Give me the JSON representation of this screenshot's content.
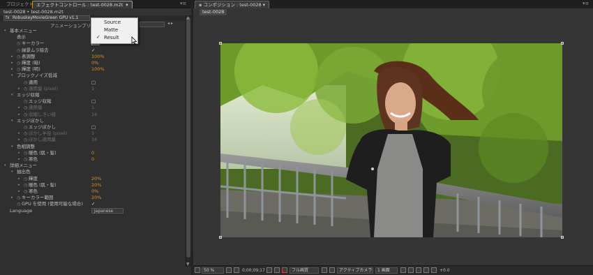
{
  "left_panel": {
    "tabs": [
      {
        "label": "プロジェクト"
      },
      {
        "label": "エフェクトコントロール : test-0028.m2t"
      }
    ],
    "menu_glyph": "▾≡",
    "subtitle": "test-0028 • test-0028.m2t",
    "effect_name": "RobuskeyMovieGreen GPU v1.1",
    "fx_label": "fx",
    "preset_label": "アニメーションプリセット"
  },
  "popup_menu": {
    "items": [
      "Source",
      "Matte",
      "Result"
    ],
    "checked_index": 2,
    "check_glyph": "✓"
  },
  "properties": [
    {
      "label": "基本メニュー",
      "value": "",
      "indent": 0,
      "tri": "▾"
    },
    {
      "label": "表示",
      "value": "",
      "indent": 1,
      "tri": ""
    },
    {
      "label": "キーカラー",
      "value": "",
      "indent": 1,
      "tri": "",
      "stopwatch": true,
      "swatch": true
    },
    {
      "label": "緑景ムラ除去",
      "value": "✓",
      "indent": 1,
      "tri": "",
      "stopwatch": true
    },
    {
      "label": "表調整",
      "value": "100%",
      "indent": 1,
      "tri": "▸",
      "stopwatch": true,
      "orange": true
    },
    {
      "label": "輝度 (暗)",
      "value": "0%",
      "indent": 1,
      "tri": "▸",
      "stopwatch": true,
      "orange": true
    },
    {
      "label": "輝度 (明)",
      "value": "100%",
      "indent": 1,
      "tri": "▸",
      "stopwatch": true,
      "orange": true
    },
    {
      "label": "ブロックノイズ低減",
      "value": "",
      "indent": 1,
      "tri": "▾"
    },
    {
      "label": "適用",
      "value": "□",
      "indent": 2,
      "tri": "",
      "stopwatch": true
    },
    {
      "label": "適用量 (pixel)",
      "value": "1",
      "indent": 2,
      "tri": "▸",
      "stopwatch": true,
      "dim": true
    },
    {
      "label": "エッジ収縮",
      "value": "",
      "indent": 1,
      "tri": "▾"
    },
    {
      "label": "エッジ収縮",
      "value": "□",
      "indent": 2,
      "tri": "",
      "stopwatch": true
    },
    {
      "label": "適用量",
      "value": "1",
      "indent": 2,
      "tri": "▸",
      "stopwatch": true,
      "dim": true
    },
    {
      "label": "収縮しきい値",
      "value": "16",
      "indent": 2,
      "tri": "▸",
      "stopwatch": true,
      "dim": true
    },
    {
      "label": "エッジぼかし",
      "value": "",
      "indent": 1,
      "tri": "▾"
    },
    {
      "label": "エッジぼかし",
      "value": "□",
      "indent": 2,
      "tri": "",
      "stopwatch": true
    },
    {
      "label": "ぼかし半径 (pixel)",
      "value": "1",
      "indent": 2,
      "tri": "▸",
      "stopwatch": true,
      "dim": true
    },
    {
      "label": "ぼかし適用量",
      "value": "16",
      "indent": 2,
      "tri": "▸",
      "stopwatch": true,
      "dim": true
    },
    {
      "label": "色相調整",
      "value": "",
      "indent": 1,
      "tri": "▾"
    },
    {
      "label": "暖色 (肌・髪)",
      "value": "0",
      "indent": 2,
      "tri": "▸",
      "stopwatch": true,
      "orange": true
    },
    {
      "label": "寒色",
      "value": "0",
      "indent": 2,
      "tri": "▸",
      "stopwatch": true,
      "orange": true
    },
    {
      "label": "詳細メニュー",
      "value": "",
      "indent": 0,
      "tri": "▾"
    },
    {
      "label": "抽出色",
      "value": "",
      "indent": 1,
      "tri": "▾"
    },
    {
      "label": "輝度",
      "value": "20%",
      "indent": 2,
      "tri": "▸",
      "stopwatch": true,
      "orange": true
    },
    {
      "label": "暖色 (肌・髪)",
      "value": "20%",
      "indent": 2,
      "tri": "▸",
      "stopwatch": true,
      "orange": true
    },
    {
      "label": "寒色",
      "value": "0%",
      "indent": 2,
      "tri": "▸",
      "stopwatch": true,
      "orange": true
    },
    {
      "label": "キーカラー範囲",
      "value": "20%",
      "indent": 1,
      "tri": "▸",
      "stopwatch": true,
      "orange": true
    },
    {
      "label": "GPU を使用 (使用可能な場合)",
      "value": "✓",
      "indent": 1,
      "tri": "",
      "stopwatch": true
    },
    {
      "label": "Language",
      "value": "Japanese",
      "indent": 0,
      "tri": "",
      "select": true
    }
  ],
  "right_panel": {
    "tab_label": "コンポジション : test-0028",
    "sub_tab": "test-0028",
    "menu_glyph": "▾≡"
  },
  "footer": {
    "zoom": "50 %",
    "timecode": "0;00;09;17",
    "resolution": "フル画質",
    "camera": "アクティブカメラ",
    "views": "1 画面",
    "exposure": "+0.0"
  },
  "colors": {
    "accent_tab": "#c8a227",
    "value_orange": "#d4952a",
    "key_swatch": "#3fae3c"
  }
}
